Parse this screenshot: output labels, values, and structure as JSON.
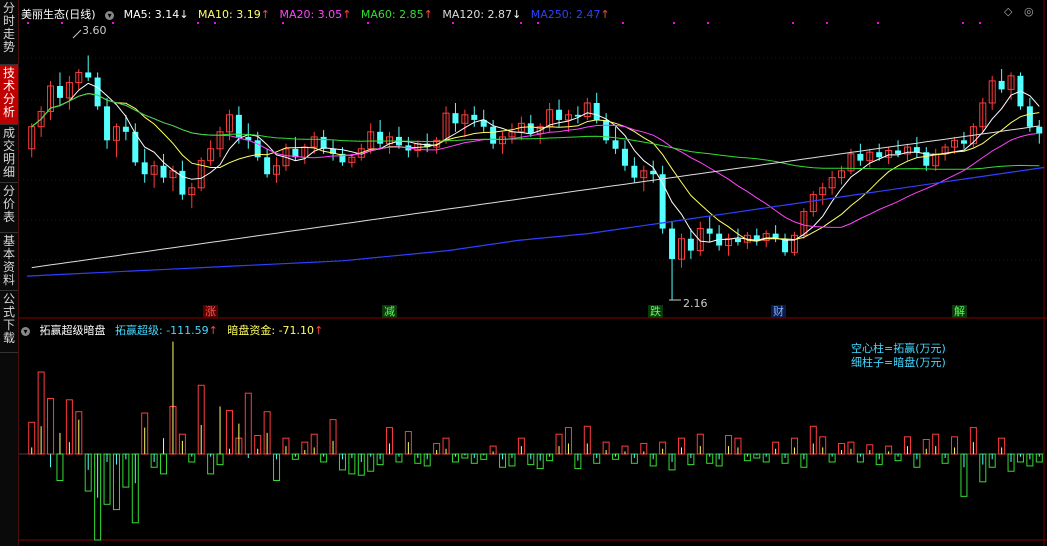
{
  "sidebar": {
    "tabs": [
      {
        "label": "分时走势",
        "active": false
      },
      {
        "label": "技术分析",
        "active": true
      },
      {
        "label": "成交明细",
        "active": false
      },
      {
        "label": "分价表",
        "active": false
      },
      {
        "label": "基本资料",
        "active": false
      },
      {
        "label": "公式下载",
        "active": false
      }
    ]
  },
  "price_header": {
    "title": "美丽生态(日线)",
    "ma5": "MA5: 3.14",
    "ma5_arrow": "↓",
    "ma10": "MA10: 3.19",
    "ma10_arrow": "↑",
    "ma20": "MA20: 3.05",
    "ma20_arrow": "↑",
    "ma60": "MA60: 2.85",
    "ma60_arrow": "↑",
    "ma120": "MA120: 2.87",
    "ma120_arrow": "↓",
    "ma250": "MA250: 2.47",
    "ma250_arrow": "↑"
  },
  "top_controls": {
    "zoom_icon": "◇",
    "close_icon": "◎"
  },
  "annotations": {
    "high": "3.60",
    "low": "2.16"
  },
  "events": [
    {
      "label": "涨",
      "color": "#ff3b3b"
    },
    {
      "label": "减",
      "color": "#39d639"
    },
    {
      "label": "跌",
      "color": "#39d639"
    },
    {
      "label": "财",
      "color": "#4a90ff"
    },
    {
      "label": "解",
      "color": "#39d639"
    }
  ],
  "indicator_header": {
    "name": "拓赢超级暗盘",
    "series1": "拓赢超级: -111.59",
    "series1_arrow": "↑",
    "series2": "暗盘资金: -71.10",
    "series2_arrow": "↑"
  },
  "indicator_note": {
    "line1": "空心柱=拓赢(万元)",
    "line2": "细柱子=暗盘(万元)"
  },
  "colors": {
    "up": "#ff3c3c",
    "down": "#54ffff",
    "ma5": "#ffffff",
    "ma10": "#ffff66",
    "ma20": "#ff44ff",
    "ma60": "#33dd33",
    "ma120": "#dddddd",
    "ma250": "#2f3fff",
    "dots": "#ff00ff",
    "grid": "#5a0000"
  },
  "chart_data": {
    "type": "candlestick",
    "price_range": [
      2.16,
      3.6
    ],
    "y_axis_lines": [
      3.6,
      3.4,
      3.2,
      3.0,
      2.8,
      2.6,
      2.4,
      2.2
    ],
    "candles": [
      [
        3.05,
        3.2,
        3.0,
        3.18
      ],
      [
        3.18,
        3.3,
        3.12,
        3.27
      ],
      [
        3.27,
        3.45,
        3.22,
        3.42
      ],
      [
        3.42,
        3.5,
        3.3,
        3.35
      ],
      [
        3.35,
        3.48,
        3.28,
        3.44
      ],
      [
        3.44,
        3.52,
        3.4,
        3.5
      ],
      [
        3.5,
        3.6,
        3.45,
        3.47
      ],
      [
        3.47,
        3.5,
        3.28,
        3.3
      ],
      [
        3.3,
        3.35,
        3.05,
        3.1
      ],
      [
        3.1,
        3.2,
        3.0,
        3.18
      ],
      [
        3.18,
        3.25,
        3.1,
        3.15
      ],
      [
        3.15,
        3.2,
        2.95,
        2.97
      ],
      [
        2.97,
        3.05,
        2.85,
        2.9
      ],
      [
        2.9,
        2.98,
        2.82,
        2.95
      ],
      [
        2.95,
        3.02,
        2.85,
        2.88
      ],
      [
        2.88,
        2.95,
        2.8,
        2.92
      ],
      [
        2.92,
        2.98,
        2.75,
        2.78
      ],
      [
        2.78,
        2.85,
        2.7,
        2.82
      ],
      [
        2.82,
        3.0,
        2.8,
        2.98
      ],
      [
        2.98,
        3.1,
        2.95,
        3.05
      ],
      [
        3.05,
        3.18,
        3.0,
        3.15
      ],
      [
        3.15,
        3.28,
        3.1,
        3.25
      ],
      [
        3.25,
        3.3,
        3.08,
        3.12
      ],
      [
        3.12,
        3.2,
        3.05,
        3.1
      ],
      [
        3.1,
        3.15,
        2.98,
        3.0
      ],
      [
        3.0,
        3.05,
        2.88,
        2.9
      ],
      [
        2.9,
        3.0,
        2.85,
        2.95
      ],
      [
        2.95,
        3.08,
        2.92,
        3.05
      ],
      [
        3.05,
        3.12,
        2.98,
        3.0
      ],
      [
        3.0,
        3.08,
        2.96,
        3.06
      ],
      [
        3.06,
        3.15,
        3.02,
        3.12
      ],
      [
        3.12,
        3.16,
        3.02,
        3.05
      ],
      [
        3.05,
        3.1,
        2.98,
        3.02
      ],
      [
        3.02,
        3.06,
        2.95,
        2.97
      ],
      [
        2.97,
        3.02,
        2.94,
        3.0
      ],
      [
        3.0,
        3.08,
        2.98,
        3.05
      ],
      [
        3.05,
        3.2,
        3.02,
        3.15
      ],
      [
        3.15,
        3.22,
        3.05,
        3.08
      ],
      [
        3.08,
        3.15,
        3.02,
        3.12
      ],
      [
        3.12,
        3.18,
        3.05,
        3.07
      ],
      [
        3.07,
        3.12,
        3.0,
        3.04
      ],
      [
        3.04,
        3.1,
        3.0,
        3.08
      ],
      [
        3.08,
        3.14,
        3.03,
        3.06
      ],
      [
        3.06,
        3.12,
        3.02,
        3.1
      ],
      [
        3.1,
        3.3,
        3.08,
        3.26
      ],
      [
        3.26,
        3.32,
        3.15,
        3.2
      ],
      [
        3.2,
        3.28,
        3.12,
        3.25
      ],
      [
        3.25,
        3.3,
        3.18,
        3.22
      ],
      [
        3.22,
        3.28,
        3.15,
        3.18
      ],
      [
        3.18,
        3.22,
        3.05,
        3.08
      ],
      [
        3.08,
        3.15,
        3.02,
        3.12
      ],
      [
        3.12,
        3.2,
        3.08,
        3.15
      ],
      [
        3.15,
        3.24,
        3.1,
        3.2
      ],
      [
        3.2,
        3.25,
        3.12,
        3.14
      ],
      [
        3.14,
        3.2,
        3.08,
        3.18
      ],
      [
        3.18,
        3.32,
        3.15,
        3.28
      ],
      [
        3.28,
        3.34,
        3.18,
        3.22
      ],
      [
        3.22,
        3.28,
        3.15,
        3.25
      ],
      [
        3.25,
        3.3,
        3.2,
        3.24
      ],
      [
        3.24,
        3.35,
        3.22,
        3.32
      ],
      [
        3.32,
        3.38,
        3.2,
        3.22
      ],
      [
        3.22,
        3.26,
        3.08,
        3.1
      ],
      [
        3.1,
        3.18,
        3.02,
        3.05
      ],
      [
        3.05,
        3.1,
        2.92,
        2.95
      ],
      [
        2.95,
        3.0,
        2.85,
        2.88
      ],
      [
        2.88,
        2.95,
        2.8,
        2.92
      ],
      [
        2.92,
        2.98,
        2.85,
        2.9
      ],
      [
        2.9,
        2.95,
        2.55,
        2.58
      ],
      [
        2.58,
        2.62,
        2.16,
        2.4
      ],
      [
        2.4,
        2.55,
        2.35,
        2.52
      ],
      [
        2.52,
        2.58,
        2.4,
        2.45
      ],
      [
        2.45,
        2.62,
        2.42,
        2.58
      ],
      [
        2.58,
        2.65,
        2.5,
        2.55
      ],
      [
        2.55,
        2.6,
        2.45,
        2.48
      ],
      [
        2.48,
        2.55,
        2.42,
        2.52
      ],
      [
        2.52,
        2.58,
        2.48,
        2.5
      ],
      [
        2.5,
        2.56,
        2.46,
        2.54
      ],
      [
        2.54,
        2.58,
        2.48,
        2.51
      ],
      [
        2.51,
        2.57,
        2.47,
        2.55
      ],
      [
        2.55,
        2.6,
        2.5,
        2.52
      ],
      [
        2.52,
        2.55,
        2.42,
        2.44
      ],
      [
        2.44,
        2.56,
        2.42,
        2.54
      ],
      [
        2.54,
        2.7,
        2.52,
        2.68
      ],
      [
        2.68,
        2.8,
        2.65,
        2.78
      ],
      [
        2.78,
        2.85,
        2.72,
        2.82
      ],
      [
        2.82,
        2.92,
        2.78,
        2.88
      ],
      [
        2.88,
        2.95,
        2.84,
        2.92
      ],
      [
        2.92,
        3.05,
        2.9,
        3.02
      ],
      [
        3.02,
        3.08,
        2.95,
        2.98
      ],
      [
        2.98,
        3.05,
        2.94,
        3.03
      ],
      [
        3.03,
        3.08,
        2.98,
        3.0
      ],
      [
        3.0,
        3.06,
        2.96,
        3.04
      ],
      [
        3.04,
        3.1,
        3.0,
        3.02
      ],
      [
        3.02,
        3.08,
        2.98,
        3.06
      ],
      [
        3.06,
        3.12,
        3.0,
        3.03
      ],
      [
        3.03,
        3.06,
        2.92,
        2.95
      ],
      [
        2.95,
        3.05,
        2.92,
        3.02
      ],
      [
        3.02,
        3.08,
        2.98,
        3.06
      ],
      [
        3.06,
        3.12,
        3.02,
        3.1
      ],
      [
        3.1,
        3.15,
        3.05,
        3.08
      ],
      [
        3.08,
        3.2,
        3.06,
        3.18
      ],
      [
        3.18,
        3.35,
        3.15,
        3.32
      ],
      [
        3.32,
        3.48,
        3.28,
        3.45
      ],
      [
        3.45,
        3.52,
        3.38,
        3.4
      ],
      [
        3.4,
        3.5,
        3.34,
        3.48
      ],
      [
        3.48,
        3.5,
        3.28,
        3.3
      ],
      [
        3.3,
        3.35,
        3.15,
        3.18
      ],
      [
        3.18,
        3.22,
        3.08,
        3.14
      ]
    ],
    "ma250": [
      2.65,
      2.66,
      2.67,
      2.68,
      2.69,
      2.7,
      2.71,
      2.72,
      2.73,
      2.74,
      2.76,
      2.78,
      2.8,
      2.83,
      2.86,
      2.88,
      2.9,
      2.93,
      2.96,
      2.99,
      3.02,
      3.05,
      3.08,
      3.11,
      3.14,
      3.17,
      3.2,
      3.23,
      3.26,
      3.29
    ],
    "indicator": {
      "ylim": [
        -650,
        900
      ],
      "hollow": [
        240,
        620,
        420,
        -200,
        410,
        320,
        -280,
        -650,
        -380,
        -420,
        -250,
        -520,
        310,
        -100,
        -150,
        360,
        150,
        -60,
        520,
        -150,
        -80,
        330,
        120,
        460,
        140,
        320,
        -200,
        120,
        -40,
        90,
        150,
        -60,
        260,
        -120,
        -150,
        -160,
        -130,
        -80,
        200,
        -60,
        170,
        -70,
        -90,
        80,
        120,
        -60,
        -30,
        -70,
        -40,
        60,
        -100,
        -90,
        120,
        -80,
        -110,
        -50,
        150,
        200,
        -110,
        210,
        -70,
        90,
        -40,
        60,
        -70,
        80,
        -90,
        90,
        -120,
        120,
        -80,
        150,
        -70,
        -90,
        140,
        120,
        -50,
        -30,
        -60,
        90,
        -70,
        120,
        -100,
        210,
        130,
        -60,
        80,
        90,
        -60,
        70,
        -80,
        60,
        -50,
        130,
        -100,
        110,
        150,
        -70,
        130,
        -320,
        200,
        -210,
        -100,
        120,
        -130,
        -60,
        -90,
        -60
      ],
      "thin": [
        50,
        210,
        -100,
        160,
        90,
        260,
        -120,
        -330,
        -60,
        -80,
        -40,
        -220,
        200,
        -60,
        120,
        850,
        100,
        -20,
        220,
        -20,
        360,
        40,
        230,
        -30,
        40,
        160,
        -40,
        60,
        -20,
        30,
        50,
        -20,
        100,
        -40,
        -30,
        -60,
        -20,
        -40,
        80,
        -20,
        90,
        -30,
        -40,
        30,
        40,
        -20,
        -10,
        -30,
        -10,
        20,
        -40,
        -30,
        60,
        -40,
        -50,
        -20,
        60,
        80,
        -50,
        80,
        -30,
        30,
        -20,
        20,
        -30,
        20,
        -40,
        40,
        -60,
        50,
        -30,
        60,
        -20,
        -40,
        60,
        50,
        -20,
        -10,
        -20,
        40,
        -30,
        50,
        -40,
        80,
        50,
        -20,
        30,
        40,
        -20,
        30,
        -40,
        20,
        -20,
        60,
        -40,
        40,
        60,
        -30,
        50,
        -100,
        90,
        -80,
        -40,
        50,
        -60,
        -20,
        -40,
        -20
      ]
    }
  }
}
